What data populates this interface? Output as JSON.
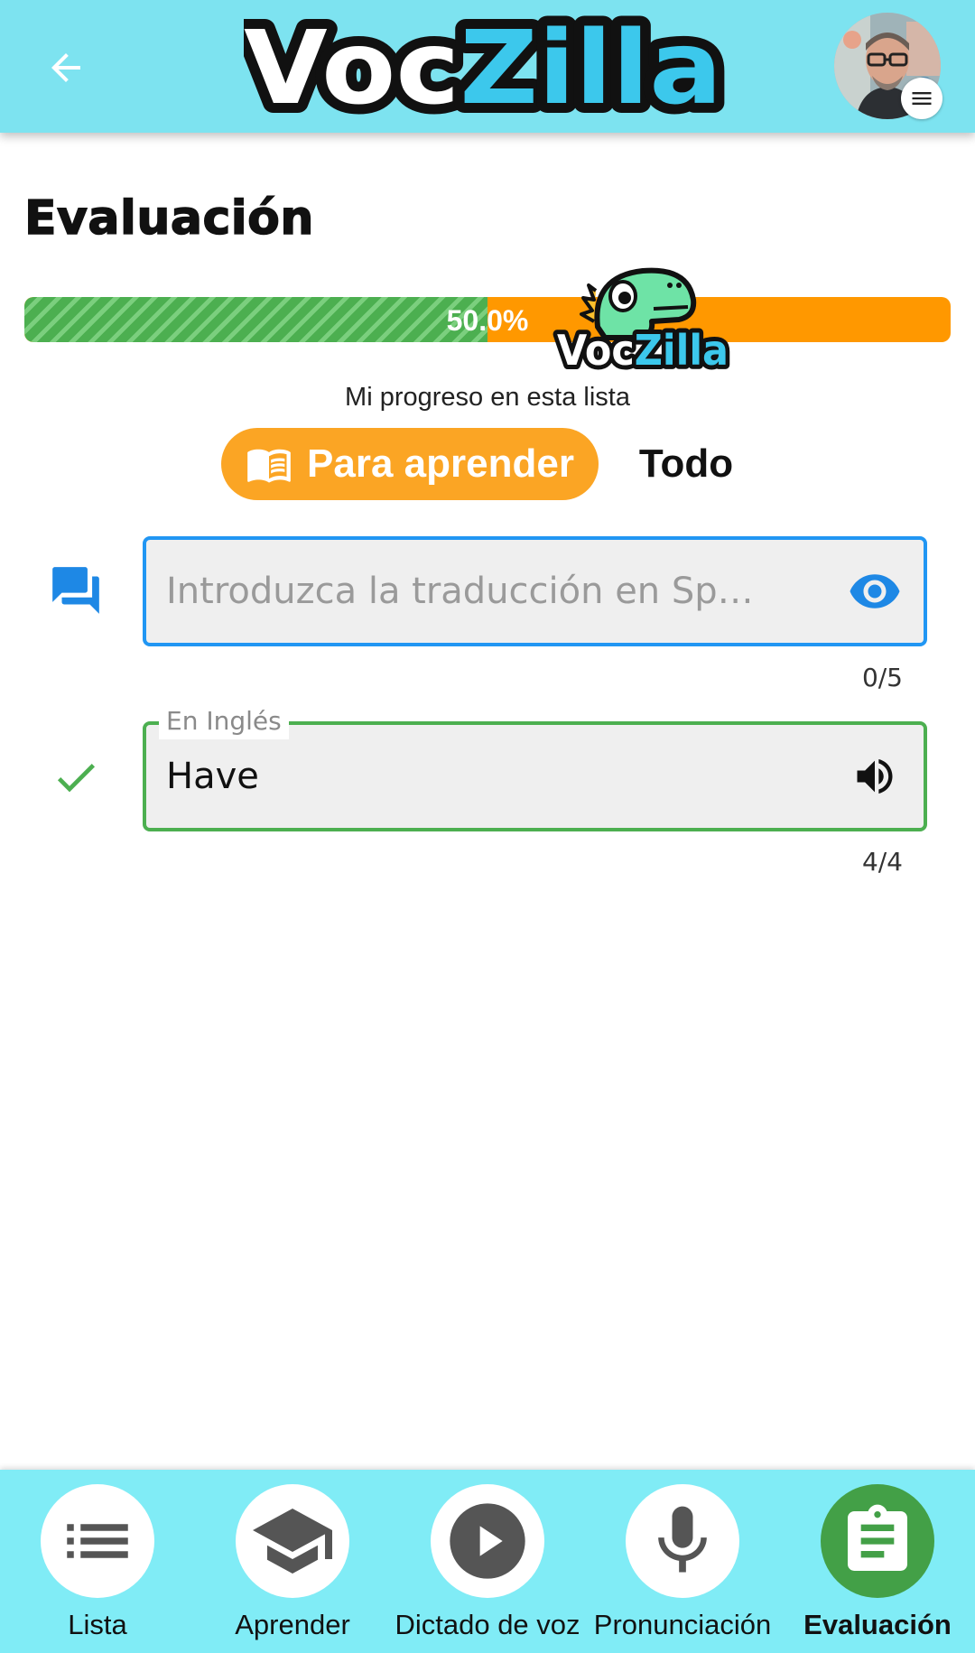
{
  "app": {
    "logo_voc": "Voc",
    "logo_zilla": "Zilla"
  },
  "header": {
    "back_icon": "arrow-left-icon",
    "menu_icon": "hamburger-menu-icon"
  },
  "page": {
    "title": "Evaluación"
  },
  "progress": {
    "value": 0.5,
    "label": "50.0%",
    "caption": "Mi progreso en esta lista",
    "colors": {
      "done": "#4caf50",
      "remaining": "#ff9800"
    }
  },
  "filters": {
    "active_label": "Para aprender",
    "active_icon": "book-icon",
    "other_label": "Todo",
    "active_color": "#fba524"
  },
  "fields": {
    "translation": {
      "icon": "forum-icon",
      "placeholder": "Introduzca la traducción en Sp…",
      "value": "",
      "suffix_icon": "eye-icon",
      "counter": "0/5"
    },
    "english": {
      "icon": "check-icon",
      "label": "En Inglés",
      "value": "Have",
      "suffix_icon": "volume-icon",
      "counter": "4/4"
    }
  },
  "bottom_nav": {
    "items": [
      {
        "label": "Lista",
        "icon": "list-icon",
        "active": false
      },
      {
        "label": "Aprender",
        "icon": "graduation-cap-icon",
        "active": false
      },
      {
        "label": "Dictado de voz",
        "icon": "play-icon",
        "active": false
      },
      {
        "label": "Pronunciación",
        "icon": "microphone-icon",
        "active": false
      },
      {
        "label": "Evaluación",
        "icon": "clipboard-icon",
        "active": true
      }
    ]
  }
}
